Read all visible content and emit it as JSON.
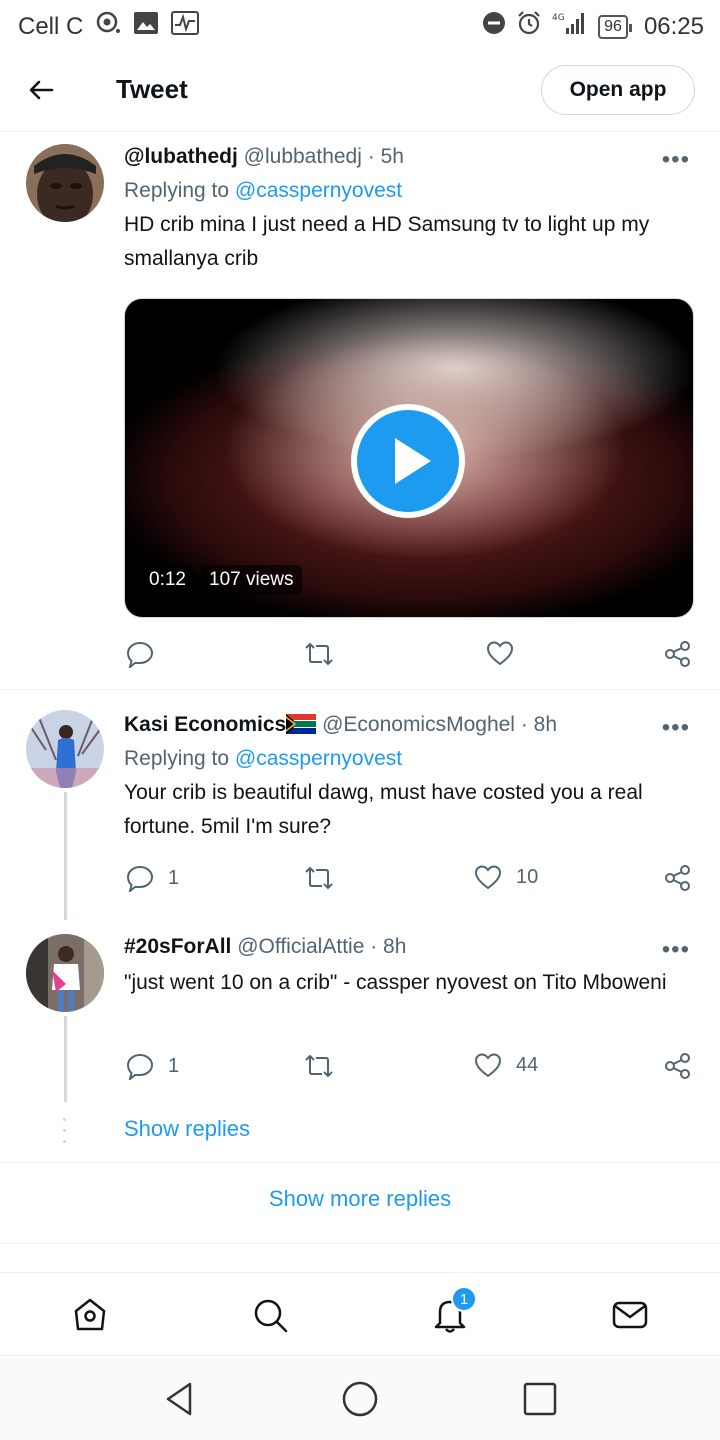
{
  "status_bar": {
    "carrier": "Cell C",
    "network": "4G",
    "battery": "96",
    "time": "06:25"
  },
  "header": {
    "title": "Tweet",
    "open_app_label": "Open app"
  },
  "tweets": [
    {
      "display_name": "@lubathedj",
      "handle": "@lubbathedj",
      "time": "· 5h",
      "replying_prefix": "Replying to",
      "replying_to": "@casspernyovest",
      "text": "HD crib mina I just need a HD Samsung tv to light up my smallanya crib",
      "video": {
        "duration": "0:12",
        "views": "107 views"
      },
      "replies": "",
      "likes": ""
    },
    {
      "display_name": "Kasi Economics",
      "flag_emoji": "🇿🇦",
      "handle": "@EconomicsMoghel",
      "time": "· 8h",
      "replying_prefix": "Replying to",
      "replying_to": "@casspernyovest",
      "text": "Your crib is beautiful dawg, must have costed you a real fortune. 5mil I'm sure?",
      "replies": "1",
      "likes": "10"
    },
    {
      "display_name": "#20sForAll",
      "handle": "@OfficialAttie",
      "time": "· 8h",
      "text": "\"just went 10 on a crib\" - cassper nyovest on Tito Mboweni",
      "replies": "1",
      "likes": "44"
    }
  ],
  "show_replies": "Show replies",
  "show_more_replies": "Show more replies",
  "bottom_nav": {
    "notification_badge": "1"
  },
  "colors": {
    "accent": "#1d9bf0",
    "secondary_text": "#536471",
    "primary_text": "#0f1419",
    "divider": "#eff3f4"
  }
}
